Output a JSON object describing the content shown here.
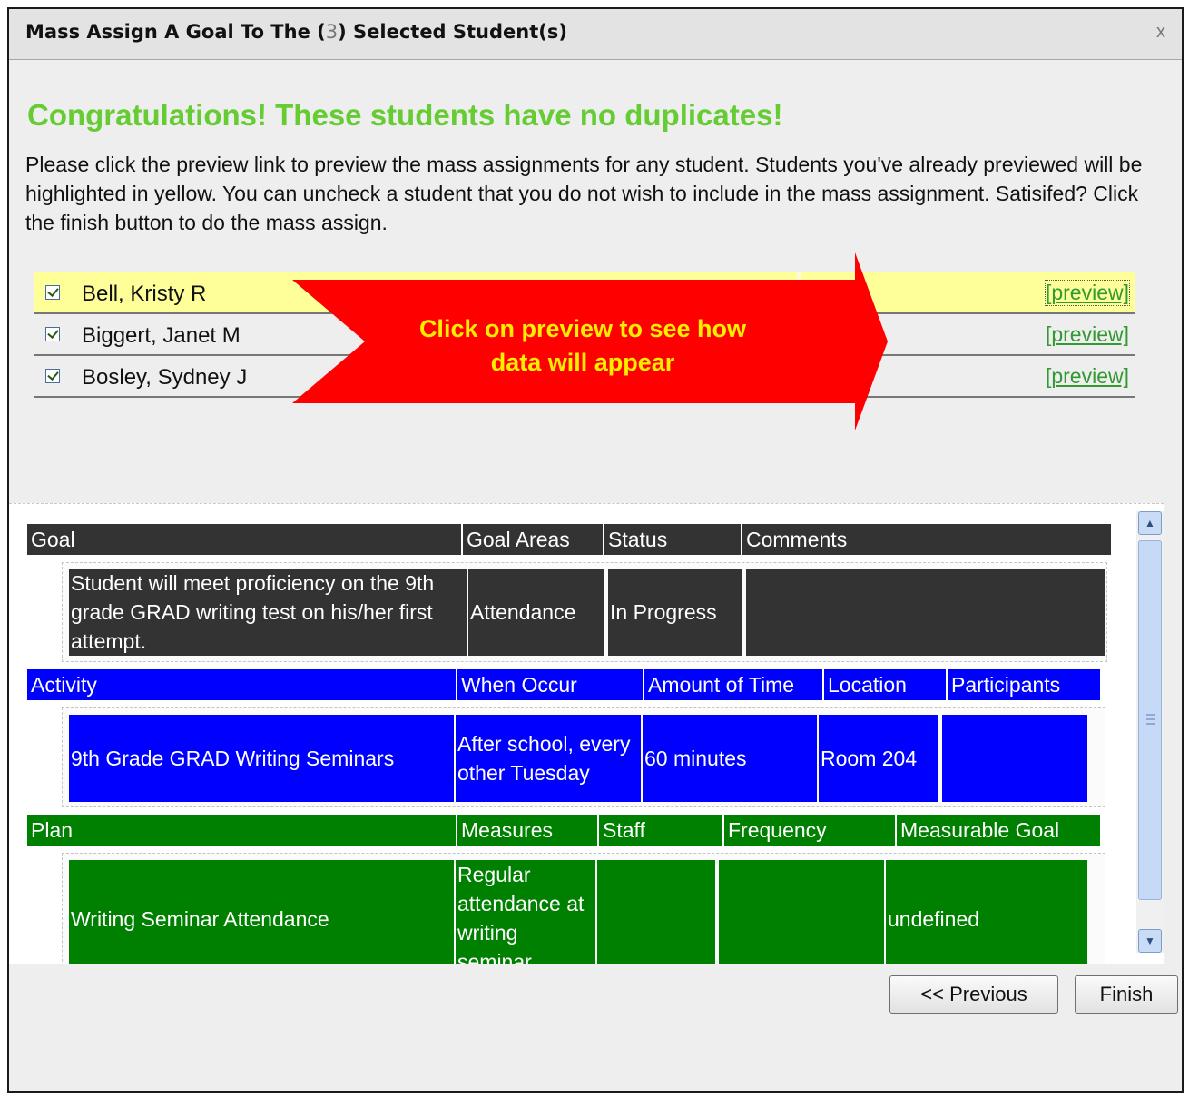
{
  "dialog": {
    "title_prefix": "Mass Assign A Goal To The (",
    "selected_count": "3",
    "title_suffix": ") Selected Student(s)",
    "close_label": "x"
  },
  "heading": "Congratulations! These students have no duplicates!",
  "instructions": "Please click the preview link to preview the mass assignments for any student. Students you've already previewed will be highlighted in yellow. You can uncheck a student that you do not wish to include in the mass assignment. Satisifed? Click the finish button to do the mass assign.",
  "students": [
    {
      "name": "Bell, Kristy R",
      "checked": true,
      "previewed": true,
      "preview_label": "[preview]"
    },
    {
      "name": "Biggert, Janet M",
      "checked": true,
      "previewed": false,
      "preview_label": "[preview]"
    },
    {
      "name": "Bosley, Sydney J",
      "checked": true,
      "previewed": false,
      "preview_label": "[preview]"
    }
  ],
  "callout": {
    "line1": "Click on preview to see how",
    "line2": "data will appear",
    "color": "#ff0000",
    "text_color": "#ffee00"
  },
  "preview": {
    "goal": {
      "headers": [
        "Goal",
        "Goal Areas",
        "Status",
        "Comments"
      ],
      "row": {
        "goal": "Student will meet proficiency on the 9th grade GRAD writing test on his/her first attempt.",
        "goal_areas": "Attendance",
        "status": "In Progress",
        "comments": ""
      }
    },
    "activity": {
      "headers": [
        "Activity",
        "When Occur",
        "Amount of Time",
        "Location",
        "Participants"
      ],
      "row": {
        "activity": "9th Grade GRAD Writing Seminars",
        "when_occur": "After school, every other Tuesday",
        "amount_of_time": "60 minutes",
        "location": "Room 204",
        "participants": ""
      }
    },
    "plan": {
      "headers": [
        "Plan",
        "Measures",
        "Staff",
        "Frequency",
        "Measurable Goal"
      ],
      "row": {
        "plan": "Writing Seminar Attendance",
        "measures": "Regular attendance at writing seminar",
        "staff": "",
        "frequency": "",
        "measurable_goal": "undefined"
      }
    }
  },
  "buttons": {
    "previous": "<< Previous",
    "finish": "Finish"
  },
  "colors": {
    "heading": "#66cc33",
    "goal_bg": "#333333",
    "activity_bg": "#0000ff",
    "plan_bg": "#008000",
    "highlight": "#ffff99",
    "link": "#339933"
  }
}
